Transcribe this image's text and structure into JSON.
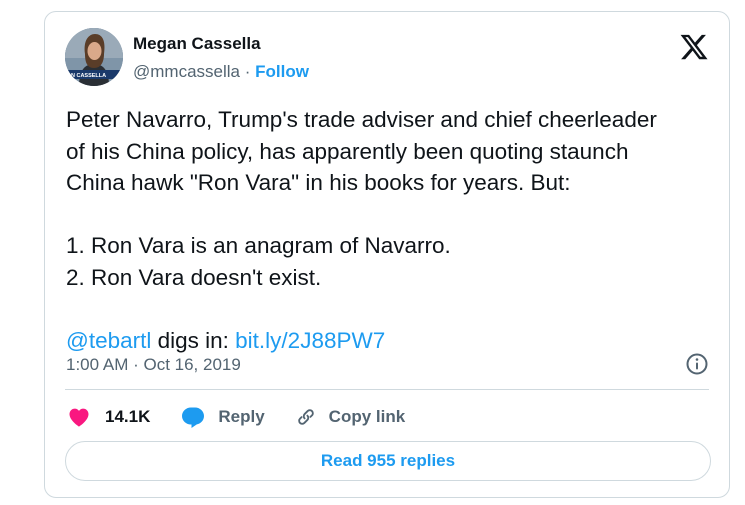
{
  "tweet": {
    "author_name": "Megan Cassella",
    "handle": "@mmcassella",
    "separator": " · ",
    "follow_label": "Follow",
    "avatar_banner_text": "AN CASSELLA",
    "body": {
      "line1": "Peter Navarro, Trump's trade adviser and chief cheerleader",
      "line2": "of his China policy, has apparently been quoting staunch",
      "line3": "China hawk \"Ron Vara\" in his books for years. But:",
      "item1": "1. Ron Vara is an anagram of Navarro.",
      "item2": "2. Ron Vara doesn't exist.",
      "mention": "@tebartl",
      "digs": " digs in: ",
      "link": "bit.ly/2J88PW7"
    },
    "timestamp": "1:00 AM · Oct 16, 2019"
  },
  "actions": {
    "likes_count": "14.1K",
    "reply_label": "Reply",
    "copy_link_label": "Copy link"
  },
  "replies_button": "Read 955 replies",
  "colors": {
    "accent": "#1d9bf0",
    "like": "#f91880",
    "text": "#0f1419",
    "muted": "#536471",
    "border": "#cfd9de"
  },
  "icons": [
    "x-logo-icon",
    "info-icon",
    "heart-icon",
    "reply-bubble-icon",
    "link-icon"
  ]
}
